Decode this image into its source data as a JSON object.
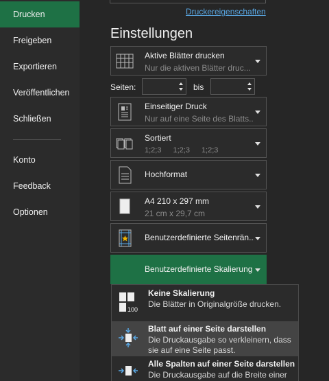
{
  "nav": {
    "items": [
      {
        "label": "Drucken",
        "active": true
      },
      {
        "label": "Freigeben"
      },
      {
        "label": "Exportieren"
      },
      {
        "label": "Veröffentlichen"
      },
      {
        "label": "Schließen"
      },
      {
        "label": "Konto"
      },
      {
        "label": "Feedback"
      },
      {
        "label": "Optionen"
      }
    ]
  },
  "main": {
    "printer_properties_link": "Druckereigenschaften",
    "settings_title": "Einstellungen",
    "print_what": {
      "title": "Aktive Blätter drucken",
      "subtitle": "Nur die aktiven Blätter druc..."
    },
    "pages": {
      "label": "Seiten:",
      "to_label": "bis",
      "from_value": "",
      "to_value": ""
    },
    "sides": {
      "title": "Einseitiger Druck",
      "subtitle": "Nur auf eine Seite des Blatts..."
    },
    "collation": {
      "title": "Sortiert",
      "sequence": [
        "1;2;3",
        "1;2;3",
        "1;2;3"
      ]
    },
    "orientation": {
      "title": "Hochformat"
    },
    "paper": {
      "title": "A4 210 x 297 mm",
      "subtitle": "21 cm x 29,7 cm"
    },
    "margins": {
      "title": "Benutzerdefinierte Seitenrän..."
    },
    "scaling": {
      "title": "Benutzerdefinierte Skalierung"
    }
  },
  "scaling_menu": {
    "items": [
      {
        "title": "Keine Skalierung",
        "desc": "Die Blätter in Originalgröße drucken.",
        "icon_badge": "100"
      },
      {
        "title": "Blatt auf einer Seite darstellen",
        "desc": "Die Druckausgabe so verkleinern, dass sie auf eine Seite passt."
      },
      {
        "title": "Alle Spalten auf einer Seite darstellen",
        "desc": "Die Druckausgabe auf die Breite einer"
      }
    ]
  },
  "colors": {
    "accent": "#1e7145",
    "link": "#5aa9e6",
    "background": "#262626"
  }
}
